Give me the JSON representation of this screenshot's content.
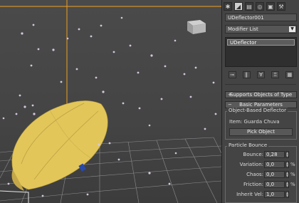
{
  "viewport": {
    "name": "Perspective viewport",
    "colors": {
      "umbrella": "#e6c85a",
      "particles": "#d7c8df",
      "grid": "#8a8a8a",
      "orange_line": "#f0a020"
    }
  },
  "panel": {
    "command_tabs": [
      {
        "name": "create-tab",
        "icon": "gear-icon",
        "glyph": "✱"
      },
      {
        "name": "modify-tab",
        "icon": "bend-icon",
        "glyph": "◢",
        "active": true
      },
      {
        "name": "hierarchy-tab",
        "icon": "hierarchy-icon",
        "glyph": "▤"
      },
      {
        "name": "motion-tab",
        "icon": "motion-icon",
        "glyph": "◎"
      },
      {
        "name": "display-tab",
        "icon": "monitor-icon",
        "glyph": "▣"
      },
      {
        "name": "utilities-tab",
        "icon": "hammer-icon",
        "glyph": "⚒"
      }
    ],
    "object_name": "UDeflector001",
    "modifier_list": "Modifier List",
    "stack_items": [
      "UDeflector"
    ],
    "stack_tools": [
      {
        "name": "pin-stack-icon",
        "glyph": "⊸"
      },
      {
        "name": "show-end-result-icon",
        "glyph": "‖"
      },
      {
        "name": "make-unique-icon",
        "glyph": "∀"
      },
      {
        "name": "remove-modifier-icon",
        "glyph": "♖"
      },
      {
        "name": "configure-sets-icon",
        "glyph": "▦"
      }
    ],
    "rollout_supports": "Supports Objects of Type",
    "rollout_basic": "Basic Parameters",
    "group_deflector": "Object-Based Deflector",
    "item_label": "Item:",
    "item_value": "Guarda Chuva",
    "pick_object": "Pick Object",
    "group_bounce": "Particle Bounce",
    "params": [
      {
        "label": "Bounce:",
        "value": "0,28",
        "unit": ""
      },
      {
        "label": "Variation:",
        "value": "0,0",
        "unit": "%"
      },
      {
        "label": "Chaos:",
        "value": "0,0",
        "unit": "%"
      },
      {
        "label": "Friction:",
        "value": "0,0",
        "unit": "%"
      },
      {
        "label": "Inherit Vel:",
        "value": "1,0",
        "unit": ""
      }
    ]
  }
}
